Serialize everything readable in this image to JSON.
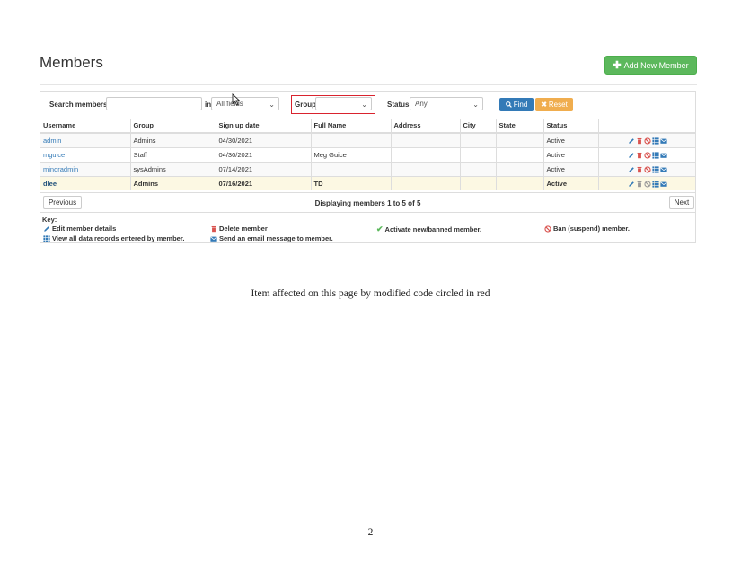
{
  "page_title": "Members",
  "add_button_label": "Add New Member",
  "search": {
    "label": "Search members",
    "value": "",
    "in_label": "in",
    "field_select": "All fields",
    "group_label": "Group",
    "group_select": "",
    "status_label": "Status",
    "status_select": "Any",
    "find_label": "Find",
    "reset_label": "Reset"
  },
  "table": {
    "headers": [
      "Username",
      "Group",
      "Sign up date",
      "Full Name",
      "Address",
      "City",
      "State",
      "Status"
    ],
    "rows": [
      {
        "username": "admin",
        "group": "Admins",
        "signup": "04/30/2021",
        "fullname": "",
        "address": "",
        "city": "",
        "state": "",
        "status": "Active"
      },
      {
        "username": "mguice",
        "group": "Staff",
        "signup": "04/30/2021",
        "fullname": "Meg Guice",
        "address": "",
        "city": "",
        "state": "",
        "status": "Active"
      },
      {
        "username": "minoradmin",
        "group": "sysAdmins",
        "signup": "07/14/2021",
        "fullname": "",
        "address": "",
        "city": "",
        "state": "",
        "status": "Active"
      },
      {
        "username": "dlee",
        "group": "Admins",
        "signup": "07/16/2021",
        "fullname": "TD",
        "address": "",
        "city": "",
        "state": "",
        "status": "Active"
      }
    ]
  },
  "pager": {
    "previous": "Previous",
    "next": "Next",
    "info": "Displaying members 1 to 5 of 5"
  },
  "key": {
    "title": "Key:",
    "edit": "Edit member details",
    "delete": "Delete member",
    "activate": "Activate new/banned member.",
    "ban": "Ban (suspend) member.",
    "records": "View all data records entered by member.",
    "email": "Send an email message to member."
  },
  "caption": "Item affected on this page by modified code circled in red",
  "page_number": "2",
  "colors": {
    "success": "#5cb85c",
    "primary": "#337ab7",
    "warning": "#f0ad4e",
    "highlight": "#d9232e",
    "danger": "#d9534f"
  }
}
